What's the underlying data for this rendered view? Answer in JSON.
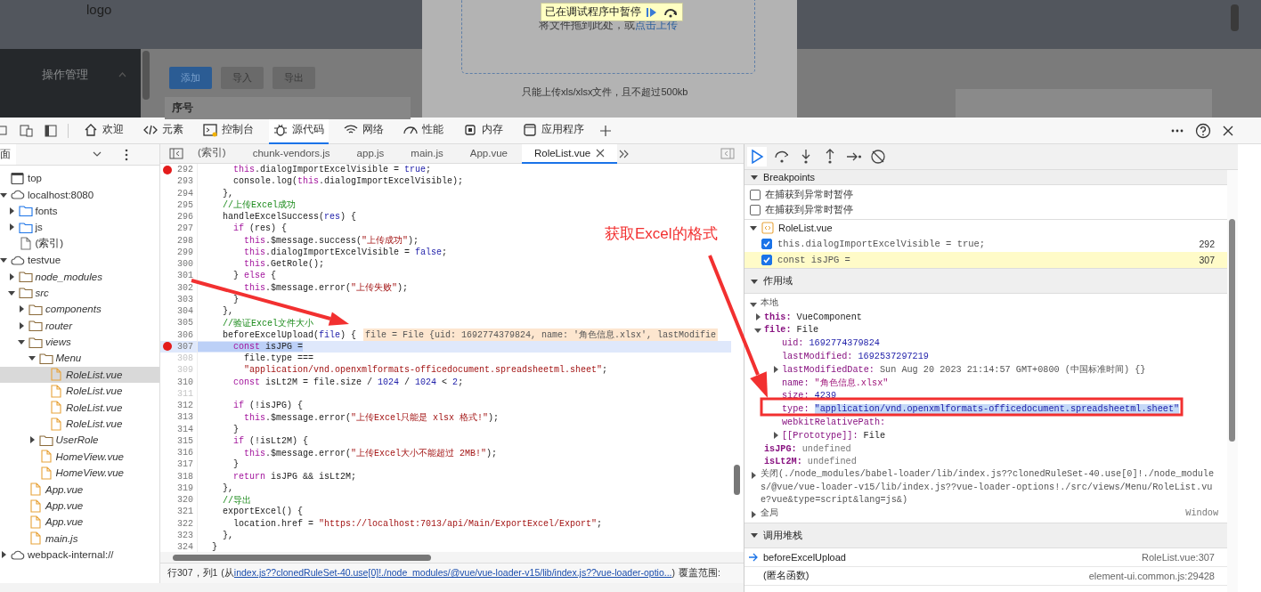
{
  "page": {
    "logo": "logo",
    "menu": [
      {
        "label": "操作管理",
        "expanded": true
      }
    ],
    "buttons": [
      {
        "label": "添加",
        "kind": "primary"
      },
      {
        "label": "导入",
        "kind": "plain"
      },
      {
        "label": "导出",
        "kind": "plain"
      }
    ],
    "table_header": "序号",
    "dialog": {
      "upload_text": "将文件拖到此处，或",
      "upload_link": "点击上传",
      "tip": "只能上传xls/xlsx文件，且不超过500kb"
    },
    "paused_banner": "已在调试程序中暂停"
  },
  "devtools_tabs": [
    {
      "label": "欢迎",
      "selected": false
    },
    {
      "label": "元素",
      "selected": false
    },
    {
      "label": "控制台",
      "selected": false
    },
    {
      "label": "源代码",
      "selected": true
    },
    {
      "label": "网络",
      "selected": false
    },
    {
      "label": "性能",
      "selected": false
    },
    {
      "label": "内存",
      "selected": false
    },
    {
      "label": "应用程序",
      "selected": false
    }
  ],
  "navigator": {
    "title": "面",
    "tree": [
      {
        "label": "top",
        "kind": "frame",
        "selected": false
      },
      {
        "label": "localhost:8080",
        "kind": "origin",
        "expanded": true,
        "selected": false,
        "children": [
          {
            "label": "fonts",
            "kind": "folder",
            "expanded": false,
            "selected": false
          },
          {
            "label": "js",
            "kind": "folder",
            "expanded": false,
            "selected": false
          },
          {
            "label": "(索引)",
            "kind": "file",
            "selected": false
          }
        ]
      },
      {
        "label": "testvue",
        "kind": "origin",
        "expanded": true,
        "selected": false,
        "children": [
          {
            "label": "node_modules",
            "kind": "source_folder",
            "expanded": false,
            "selected": false
          },
          {
            "label": "src",
            "kind": "source_folder",
            "expanded": true,
            "selected": false,
            "children": [
              {
                "label": "components",
                "kind": "source_folder",
                "expanded": false,
                "selected": false
              },
              {
                "label": "router",
                "kind": "source_folder",
                "expanded": false,
                "selected": false
              },
              {
                "label": "views",
                "kind": "source_folder",
                "expanded": true,
                "selected": false,
                "children": [
                  {
                    "label": "Menu",
                    "kind": "source_folder",
                    "expanded": true,
                    "selected": false,
                    "children": [
                      {
                        "label": "RoleList.vue",
                        "kind": "source",
                        "selected": true
                      },
                      {
                        "label": "RoleList.vue",
                        "kind": "source",
                        "selected": false
                      },
                      {
                        "label": "RoleList.vue",
                        "kind": "source",
                        "selected": false
                      },
                      {
                        "label": "RoleList.vue",
                        "kind": "source",
                        "selected": false
                      }
                    ]
                  },
                  {
                    "label": "UserRole",
                    "kind": "source_folder",
                    "expanded": false,
                    "selected": false
                  },
                  {
                    "label": "HomeView.vue",
                    "kind": "source",
                    "selected": false
                  },
                  {
                    "label": "HomeView.vue",
                    "kind": "source",
                    "selected": false
                  }
                ]
              },
              {
                "label": "App.vue",
                "kind": "source",
                "selected": false
              },
              {
                "label": "App.vue",
                "kind": "source",
                "selected": false
              },
              {
                "label": "App.vue",
                "kind": "source",
                "selected": false
              },
              {
                "label": "main.js",
                "kind": "source",
                "selected": false
              }
            ]
          }
        ]
      },
      {
        "label": "webpack-internal://",
        "kind": "origin",
        "expanded": false,
        "selected": false
      }
    ]
  },
  "editor": {
    "tabs": [
      {
        "label": "(索引)",
        "selected": false
      },
      {
        "label": "chunk-vendors.js",
        "selected": false
      },
      {
        "label": "app.js",
        "selected": false
      },
      {
        "label": "main.js",
        "selected": false
      },
      {
        "label": "App.vue",
        "selected": false
      },
      {
        "label": "RoleList.vue",
        "selected": true
      }
    ],
    "lines": [
      {
        "number": "292",
        "breakpoint": true,
        "breakable": true,
        "current": false,
        "tokens": [
          {
            "kind": "keyword",
            "text": "      this"
          },
          {
            "kind": "plain",
            "text": ".dialogImportExcelVisible = "
          },
          {
            "kind": "literal",
            "text": "true"
          },
          {
            "kind": "plain",
            "text": ";"
          }
        ]
      },
      {
        "number": "293",
        "breakpoint": false,
        "breakable": true,
        "current": false,
        "tokens": [
          {
            "kind": "plain",
            "text": "      console.log("
          },
          {
            "kind": "keyword",
            "text": "this"
          },
          {
            "kind": "plain",
            "text": ".dialogImportExcelVisible);"
          }
        ]
      },
      {
        "number": "294",
        "breakpoint": false,
        "breakable": true,
        "current": false,
        "tokens": [
          {
            "kind": "plain",
            "text": "    },"
          }
        ]
      },
      {
        "number": "295",
        "breakpoint": false,
        "breakable": true,
        "current": false,
        "tokens": [
          {
            "kind": "comment",
            "text": "    //上传Excel成功"
          }
        ]
      },
      {
        "number": "296",
        "breakpoint": false,
        "breakable": true,
        "current": false,
        "tokens": [
          {
            "kind": "plain",
            "text": "    handleExcelSuccess("
          },
          {
            "kind": "literal",
            "text": "res"
          },
          {
            "kind": "plain",
            "text": ") {"
          }
        ]
      },
      {
        "number": "297",
        "breakpoint": false,
        "breakable": true,
        "current": false,
        "tokens": [
          {
            "kind": "keyword",
            "text": "      if"
          },
          {
            "kind": "plain",
            "text": " (res) {"
          }
        ]
      },
      {
        "number": "298",
        "breakpoint": false,
        "breakable": true,
        "current": false,
        "tokens": [
          {
            "kind": "keyword",
            "text": "        this"
          },
          {
            "kind": "plain",
            "text": ".$message.success("
          },
          {
            "kind": "string",
            "text": "\"上传成功\""
          },
          {
            "kind": "plain",
            "text": ");"
          }
        ]
      },
      {
        "number": "299",
        "breakpoint": false,
        "breakable": true,
        "current": false,
        "tokens": [
          {
            "kind": "keyword",
            "text": "        this"
          },
          {
            "kind": "plain",
            "text": ".dialogImportExcelVisible = "
          },
          {
            "kind": "literal",
            "text": "false"
          },
          {
            "kind": "plain",
            "text": ";"
          }
        ]
      },
      {
        "number": "300",
        "breakpoint": false,
        "breakable": true,
        "current": false,
        "tokens": [
          {
            "kind": "keyword",
            "text": "        this"
          },
          {
            "kind": "plain",
            "text": ".GetRole();"
          }
        ]
      },
      {
        "number": "301",
        "breakpoint": false,
        "breakable": true,
        "current": false,
        "tokens": [
          {
            "kind": "plain",
            "text": "      } "
          },
          {
            "kind": "keyword",
            "text": "else"
          },
          {
            "kind": "plain",
            "text": " {"
          }
        ]
      },
      {
        "number": "302",
        "breakpoint": false,
        "breakable": true,
        "current": false,
        "tokens": [
          {
            "kind": "keyword",
            "text": "        this"
          },
          {
            "kind": "plain",
            "text": ".$message.error("
          },
          {
            "kind": "string",
            "text": "\"上传失败\""
          },
          {
            "kind": "plain",
            "text": ");"
          }
        ]
      },
      {
        "number": "303",
        "breakpoint": false,
        "breakable": true,
        "current": false,
        "tokens": [
          {
            "kind": "plain",
            "text": "      }"
          }
        ]
      },
      {
        "number": "304",
        "breakpoint": false,
        "breakable": true,
        "current": false,
        "tokens": [
          {
            "kind": "plain",
            "text": "    },"
          }
        ]
      },
      {
        "number": "305",
        "breakpoint": false,
        "breakable": true,
        "current": false,
        "tokens": [
          {
            "kind": "comment",
            "text": "    //验证Excel文件大小"
          }
        ]
      },
      {
        "number": "306",
        "breakpoint": false,
        "breakable": true,
        "current": false,
        "tokens": [
          {
            "kind": "plain",
            "text": "    beforeExcelUpload("
          },
          {
            "kind": "literal",
            "text": "file"
          },
          {
            "kind": "plain",
            "text": ") {"
          }
        ],
        "inline_value": "file = File {uid: 1692774379824, name: '角色信息.xlsx', lastModifie"
      },
      {
        "number": "307",
        "breakpoint": true,
        "breakable": true,
        "current": true,
        "tokens": [
          {
            "kind": "keyword",
            "text": "      const"
          },
          {
            "kind": "plain",
            "text": " isJPG ="
          }
        ]
      },
      {
        "number": "308",
        "breakpoint": false,
        "breakable": false,
        "current": false,
        "tokens": [
          {
            "kind": "plain",
            "text": "        file.type ==="
          }
        ]
      },
      {
        "number": "309",
        "breakpoint": false,
        "breakable": false,
        "current": false,
        "tokens": [
          {
            "kind": "string",
            "text": "        \"application/vnd.openxmlformats-officedocument.spreadsheetml.sheet\""
          },
          {
            "kind": "plain",
            "text": ";"
          }
        ]
      },
      {
        "number": "310",
        "breakpoint": false,
        "breakable": true,
        "current": false,
        "tokens": [
          {
            "kind": "keyword",
            "text": "      const"
          },
          {
            "kind": "plain",
            "text": " isLt2M = file.size / "
          },
          {
            "kind": "literal",
            "text": "1024"
          },
          {
            "kind": "plain",
            "text": " / "
          },
          {
            "kind": "literal",
            "text": "1024"
          },
          {
            "kind": "plain",
            "text": " < "
          },
          {
            "kind": "literal",
            "text": "2"
          },
          {
            "kind": "plain",
            "text": ";"
          }
        ]
      },
      {
        "number": "311",
        "breakpoint": false,
        "breakable": false,
        "current": false
      },
      {
        "number": "312",
        "breakpoint": false,
        "breakable": true,
        "current": false,
        "tokens": [
          {
            "kind": "keyword",
            "text": "      if"
          },
          {
            "kind": "plain",
            "text": " (!isJPG) {"
          }
        ]
      },
      {
        "number": "313",
        "breakpoint": false,
        "breakable": true,
        "current": false,
        "tokens": [
          {
            "kind": "keyword",
            "text": "        this"
          },
          {
            "kind": "plain",
            "text": ".$message.error("
          },
          {
            "kind": "string",
            "text": "\"上传Excel只能是 xlsx 格式!\""
          },
          {
            "kind": "plain",
            "text": ");"
          }
        ]
      },
      {
        "number": "314",
        "breakpoint": false,
        "breakable": true,
        "current": false,
        "tokens": [
          {
            "kind": "plain",
            "text": "      }"
          }
        ]
      },
      {
        "number": "315",
        "breakpoint": false,
        "breakable": true,
        "current": false,
        "tokens": [
          {
            "kind": "keyword",
            "text": "      if"
          },
          {
            "kind": "plain",
            "text": " (!isLt2M) {"
          }
        ]
      },
      {
        "number": "316",
        "breakpoint": false,
        "breakable": true,
        "current": false,
        "tokens": [
          {
            "kind": "keyword",
            "text": "        this"
          },
          {
            "kind": "plain",
            "text": ".$message.error("
          },
          {
            "kind": "string",
            "text": "\"上传Excel大小不能超过 2MB!\""
          },
          {
            "kind": "plain",
            "text": ");"
          }
        ]
      },
      {
        "number": "317",
        "breakpoint": false,
        "breakable": true,
        "current": false,
        "tokens": [
          {
            "kind": "plain",
            "text": "      }"
          }
        ]
      },
      {
        "number": "318",
        "breakpoint": false,
        "breakable": true,
        "current": false,
        "tokens": [
          {
            "kind": "keyword",
            "text": "      return"
          },
          {
            "kind": "plain",
            "text": " isJPG && isLt2M;"
          }
        ]
      },
      {
        "number": "319",
        "breakpoint": false,
        "breakable": true,
        "current": false,
        "tokens": [
          {
            "kind": "plain",
            "text": "    },"
          }
        ]
      },
      {
        "number": "320",
        "breakpoint": false,
        "breakable": true,
        "current": false,
        "tokens": [
          {
            "kind": "comment",
            "text": "    //导出"
          }
        ]
      },
      {
        "number": "321",
        "breakpoint": false,
        "breakable": true,
        "current": false,
        "tokens": [
          {
            "kind": "plain",
            "text": "    exportExcel() {"
          }
        ]
      },
      {
        "number": "322",
        "breakpoint": false,
        "breakable": true,
        "current": false,
        "tokens": [
          {
            "kind": "plain",
            "text": "      location.href = "
          },
          {
            "kind": "string",
            "text": "\"https://localhost:7013/api/Main/ExportExcel/Export\""
          },
          {
            "kind": "plain",
            "text": ";"
          }
        ]
      },
      {
        "number": "323",
        "breakpoint": false,
        "breakable": true,
        "current": false,
        "tokens": [
          {
            "kind": "plain",
            "text": "    },"
          }
        ]
      },
      {
        "number": "324",
        "breakpoint": false,
        "breakable": true,
        "current": false,
        "tokens": [
          {
            "kind": "plain",
            "text": "  }"
          }
        ]
      }
    ]
  },
  "status_bar": {
    "position": "行307，列1",
    "source_open": "(从",
    "source_link": "index.js??clonedRuleSet-40.use[0]!./node_modules/@vue/vue-loader-v15/lib/index.js??vue-loader-optio...",
    "source_close": ")",
    "coverage": "覆盖范围:"
  },
  "debugger": {
    "breakpoints": {
      "title": "Breakpoints",
      "expanded": true,
      "pause_options": [
        {
          "label": "在捕获到异常时暂停",
          "checked": false
        },
        {
          "label": "在捕获到异常时暂停",
          "checked": false
        }
      ],
      "files": [
        {
          "name": "RoleList.vue",
          "expanded": true,
          "breakpoints": [
            {
              "code": "this.dialogImportExcelVisible = true;",
              "line": "292",
              "checked": true,
              "paused": false
            },
            {
              "code": "const isJPG =",
              "line": "307",
              "checked": true,
              "paused": true
            }
          ]
        }
      ]
    },
    "scope": {
      "title": "作用域",
      "expanded": true,
      "groups": [
        {
          "label": "本地",
          "expanded": true,
          "entries": [
            {
              "key": "this:",
              "value": "VueComponent",
              "kind": "object",
              "expanded": false
            },
            {
              "key": "file:",
              "value": "File",
              "kind": "object",
              "expanded": true,
              "children": [
                {
                  "key": "uid:",
                  "value": "1692774379824",
                  "kind": "number"
                },
                {
                  "key": "lastModified:",
                  "value": "1692537297219",
                  "kind": "number"
                },
                {
                  "key": "lastModifiedDate:",
                  "value": "Sun Aug 20 2023 21:14:57 GMT+0800 (中国标准时间) {}",
                  "kind": "date",
                  "expanded": false
                },
                {
                  "key": "name:",
                  "value": "\"角色信息.xlsx\"",
                  "kind": "string"
                },
                {
                  "key": "size:",
                  "value": "4239",
                  "kind": "number"
                },
                {
                  "key": "type:",
                  "value": "\"application/vnd.openxmlformats-officedocument.spreadsheetml.sheet\"",
                  "kind": "string",
                  "selected": true
                },
                {
                  "key": "webkitRelativePath:"
                },
                {
                  "key": "[[Prototype]]:",
                  "value": "File",
                  "kind": "object",
                  "expanded": false
                }
              ]
            },
            {
              "key": "isJPG:",
              "value": "undefined",
              "kind": "undefined"
            },
            {
              "key": "isLt2M:",
              "value": "undefined",
              "kind": "undefined"
            }
          ]
        },
        {
          "label": "关闭(./node_modules/babel-loader/lib/index.js??clonedRuleSet-40.use[0]!./node_modules/@vue/vue-loader-v15/lib/index.js??vue-loader-options!./src/views/Menu/RoleList.vue?vue&type=script&lang=js&)",
          "expanded": false
        },
        {
          "label": "全局",
          "value": "Window",
          "expanded": false
        }
      ]
    },
    "call_stack": {
      "title": "调用堆栈",
      "expanded": true,
      "frames": [
        {
          "function": "beforeExcelUpload",
          "location": "RoleList.vue:307",
          "selected": true
        },
        {
          "function": "(匿名函数)",
          "location": "element-ui.common.js:29428",
          "selected": false
        }
      ]
    }
  },
  "annotation": {
    "label": "获取Excel的格式"
  }
}
